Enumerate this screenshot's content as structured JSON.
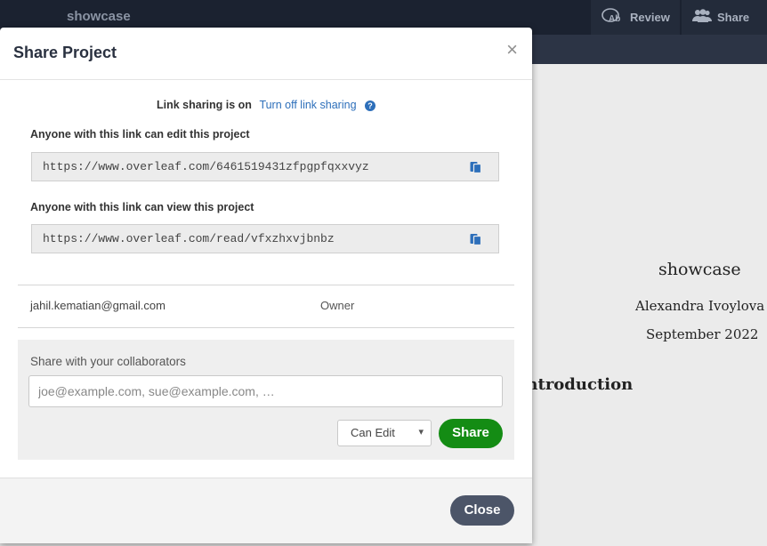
{
  "app": {
    "project_title": "showcase",
    "review_label": "Review",
    "share_label": "Share"
  },
  "pdf": {
    "doc_title": "showcase",
    "author": "Alexandra Ivoylova",
    "date": "September 2022",
    "section": "Introduction"
  },
  "modal": {
    "title": "Share Project",
    "close_symbol": "×",
    "link_sharing_status": "Link sharing is on",
    "link_sharing_toggle": "Turn off link sharing",
    "edit_label": "Anyone with this link can edit this project",
    "edit_link": "https://www.overleaf.com/6461519431zfpgpfqxxvyz",
    "view_label": "Anyone with this link can view this project",
    "view_link": "https://www.overleaf.com/read/vfxzhxvjbnbz",
    "members": [
      {
        "email": "jahil.kematian@gmail.com",
        "role": "Owner"
      }
    ],
    "collab_label": "Share with your collaborators",
    "collab_placeholder": "joe@example.com, sue@example.com, …",
    "permission": "Can Edit",
    "share_button": "Share",
    "close_button": "Close"
  },
  "colors": {
    "link": "#2d6fba",
    "share_green": "#148c14",
    "close_button": "#4c5568",
    "topbar": "#1b2230"
  },
  "icons": {
    "review": "review-icon",
    "share": "users-icon",
    "copy": "copy-icon",
    "help": "question-circle-icon"
  }
}
